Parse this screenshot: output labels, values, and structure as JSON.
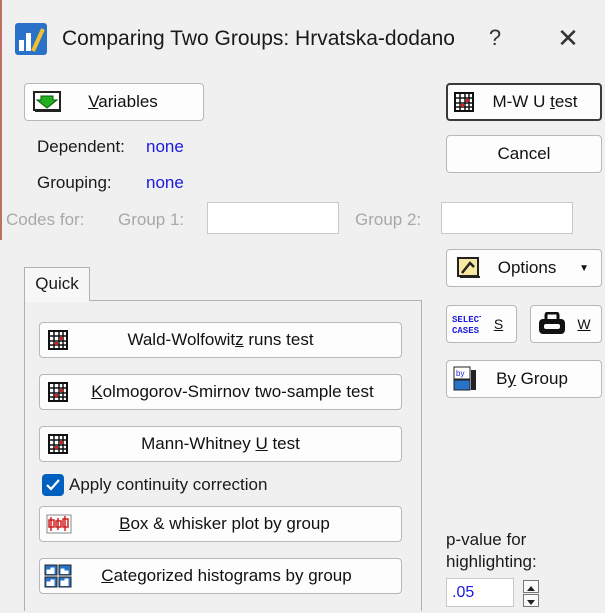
{
  "window": {
    "title": "Comparing Two Groups: Hrvatska-dodano",
    "help_glyph": "?",
    "close_glyph": "✕"
  },
  "variables": {
    "button_label_u": "V",
    "button_label_rest": "ariables",
    "dependent_label": "Dependent:",
    "dependent_value": "none",
    "grouping_label": "Grouping:",
    "grouping_value": "none",
    "codes_label": "Codes for:",
    "group1_label": "Group 1:",
    "group2_label": "Group 2:",
    "group1_value": "",
    "group2_value": ""
  },
  "tabs": [
    {
      "label": "Quick"
    }
  ],
  "quick": {
    "wald_pre": "Wald-Wolfowit",
    "wald_u": "z",
    "wald_post": " runs test",
    "ks_u": "K",
    "ks_post": "olmogorov-Smirnov two-sample test",
    "mw_pre": "Mann-Whitney ",
    "mw_u": "U",
    "mw_post": " test",
    "continuity_label": "Apply continuity correction",
    "continuity_checked": true,
    "box_u": "B",
    "box_post": "ox & whisker plot by group",
    "hist_u": "C",
    "hist_post": "ategorized histograms by group"
  },
  "right": {
    "mwu_pre": "M-W U ",
    "mwu_u": "t",
    "mwu_post": "est",
    "cancel_label": "Cancel",
    "options_label": "Options",
    "select_cases_icon_text": "SELECT CASES",
    "s_label": "S",
    "w_label": "W",
    "bygroup_pre": "B",
    "bygroup_u": "y",
    "bygroup_post": " Group",
    "pvalue_label_line1": "p-value for",
    "pvalue_label_line2": "highlighting:",
    "pvalue_value": ".05"
  },
  "colors": {
    "accent_blue": "#1a1ae0",
    "checkbox_blue": "#0060c0",
    "icon_red": "#d02020"
  },
  "icons": [
    "statistica-app-icon",
    "variables-icon",
    "grid-icon",
    "options-icon",
    "select-cases-icon",
    "weight-icon",
    "by-group-icon",
    "box-whisker-icon",
    "histogram-icon",
    "checkmark-icon",
    "spin-up-icon",
    "spin-down-icon"
  ]
}
